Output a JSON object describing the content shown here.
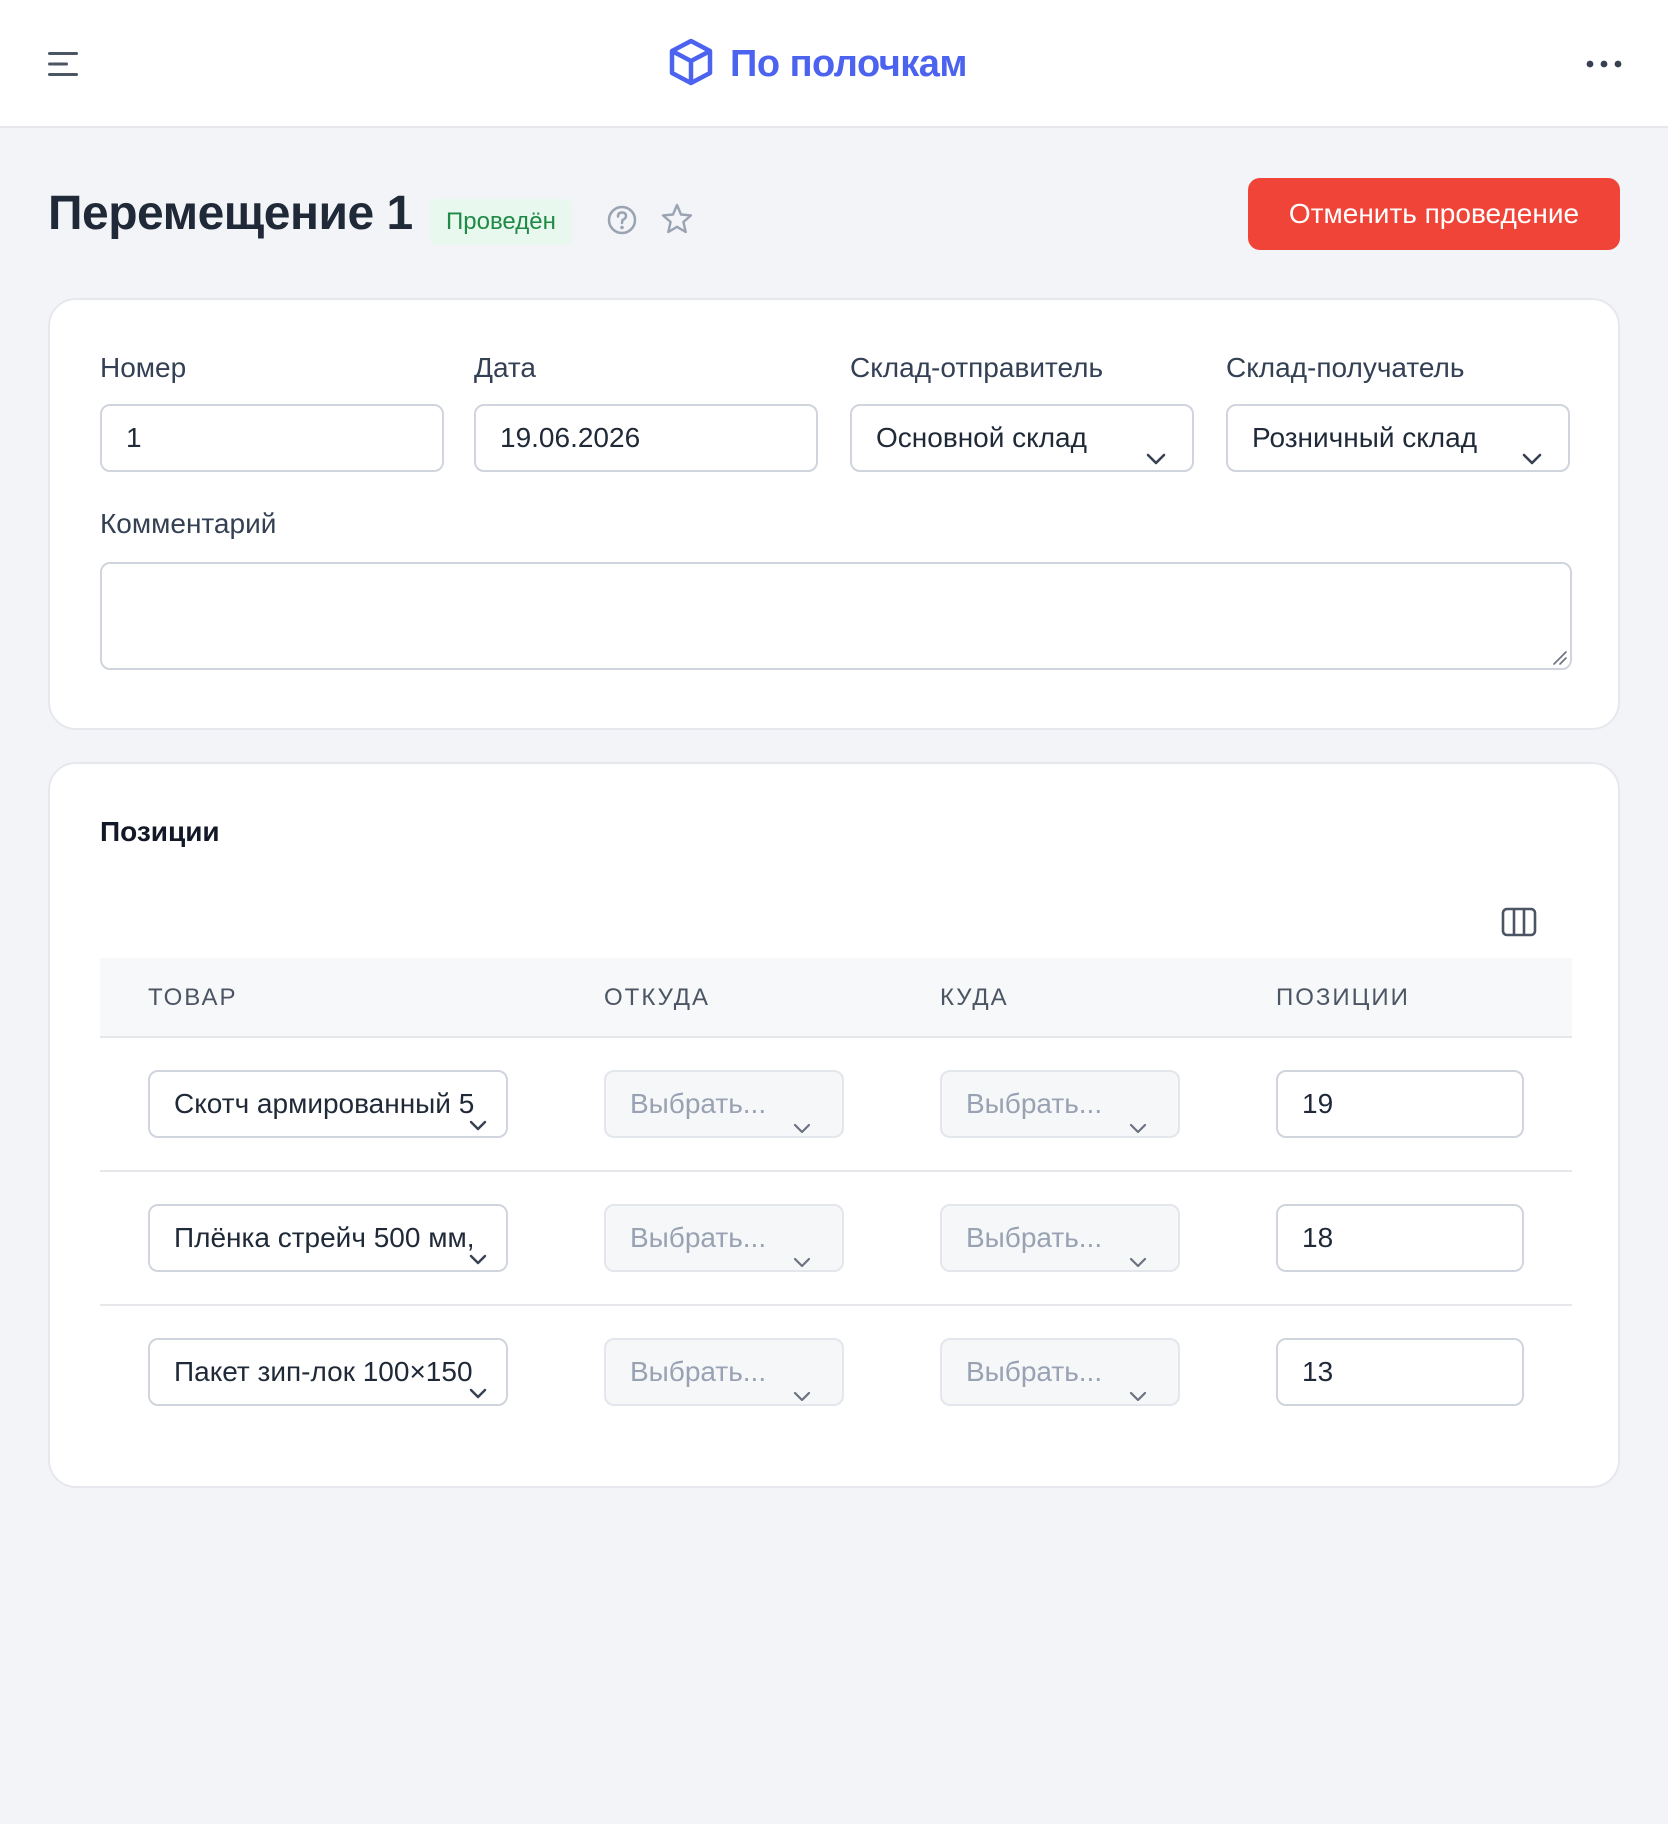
{
  "header": {
    "brand_name": "По полочкам",
    "brand_color": "#4c63f0",
    "menu_icon": "hamburger-menu-icon",
    "more_icon": "more-horizontal-icon"
  },
  "document": {
    "title": "Перемещение 1",
    "status": "Проведён",
    "status_color": "#1e8a46",
    "cancel_label": "Отменить проведение",
    "cancel_color": "#f04438"
  },
  "form": {
    "number_label": "Номер",
    "number_value": "1",
    "date_label": "Дата",
    "date_value": "19.06.2026",
    "sender_label": "Склад-отправитель",
    "sender_value": "Основной склад",
    "receiver_label": "Склад-получатель",
    "receiver_value": "Розничный склад",
    "comment_label": "Комментарий",
    "comment_value": ""
  },
  "positions": {
    "title": "Позиции",
    "columns": [
      "ТОВАР",
      "ОТКУДА",
      "КУДА",
      "ПОЗИЦИИ"
    ],
    "rows": [
      {
        "product": "Скотч армированный 5",
        "from": "Выбрать...",
        "to": "Выбрать...",
        "qty": "19"
      },
      {
        "product": "Плёнка стрейч 500 мм,",
        "from": "Выбрать...",
        "to": "Выбрать...",
        "qty": "18"
      },
      {
        "product": "Пакет зип-лок 100×150",
        "from": "Выбрать...",
        "to": "Выбрать...",
        "qty": "13"
      }
    ]
  }
}
